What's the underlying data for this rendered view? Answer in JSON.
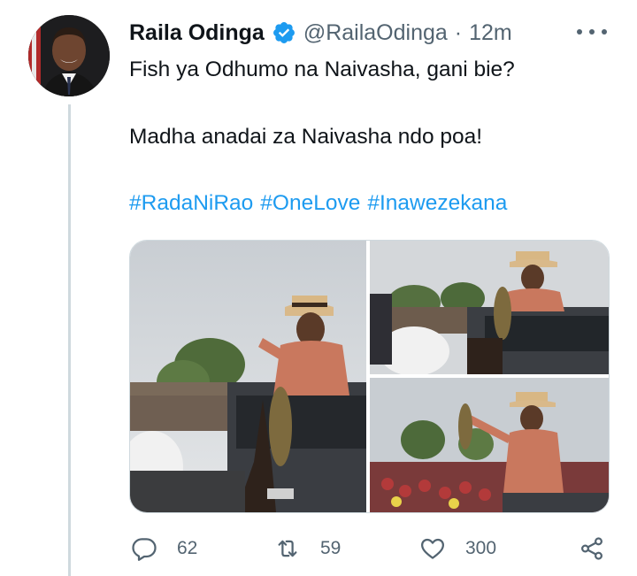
{
  "tweet": {
    "author_name": "Raila Odinga",
    "handle": "@RailaOdinga",
    "separator": "·",
    "time": "12m",
    "lines": [
      "Fish ya Odhumo na Naivasha, gani bie?",
      "Madha anadai za Naivasha ndo poa!"
    ],
    "hashtags": [
      "#RadaNiRao",
      "#OneLove",
      "#Inawezekana"
    ],
    "media_count": 3
  },
  "actions": {
    "reply_count": "62",
    "retweet_count": "59",
    "like_count": "300"
  },
  "colors": {
    "text": "#0f1419",
    "secondary": "#536471",
    "accent": "#1d9bf0",
    "thread_line": "#cfd9de"
  },
  "icons": [
    "verified-badge-icon",
    "more-icon",
    "reply-icon",
    "retweet-icon",
    "like-icon",
    "share-icon"
  ]
}
